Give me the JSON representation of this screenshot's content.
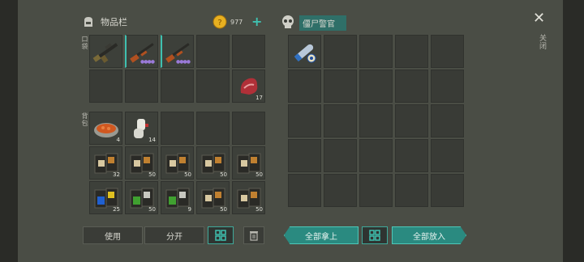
{
  "inventory": {
    "title": "物品栏",
    "pocket_label": "口袋",
    "backpack_label": "背包",
    "coins": "977",
    "add_symbol": "+"
  },
  "pocket_items": [
    {
      "icon": "rifle-icon",
      "count": ""
    },
    {
      "icon": "shotgun-icon",
      "count": "",
      "dots": "●●●●"
    },
    {
      "icon": "shotgun-icon",
      "count": "",
      "dots": "●●●●"
    },
    {
      "icon": "",
      "count": ""
    },
    {
      "icon": "",
      "count": ""
    },
    {
      "icon": "",
      "count": ""
    },
    {
      "icon": "",
      "count": ""
    },
    {
      "icon": "",
      "count": ""
    },
    {
      "icon": "",
      "count": ""
    },
    {
      "icon": "raw-meat-icon",
      "count": "17"
    }
  ],
  "backpack_items": [
    {
      "icon": "stew-bowl-icon",
      "count": "4"
    },
    {
      "icon": "bandage-icon",
      "count": "14"
    },
    {
      "icon": "",
      "count": ""
    },
    {
      "icon": "",
      "count": ""
    },
    {
      "icon": "",
      "count": ""
    },
    {
      "icon": "wood-plank-icon",
      "count": "32"
    },
    {
      "icon": "wood-plank-icon",
      "count": "50"
    },
    {
      "icon": "wood-plank-icon",
      "count": "50"
    },
    {
      "icon": "wood-plank-icon",
      "count": "50"
    },
    {
      "icon": "wood-plank-icon",
      "count": "50"
    },
    {
      "icon": "blue-paint-icon",
      "count": "25"
    },
    {
      "icon": "green-paint-icon",
      "count": "50"
    },
    {
      "icon": "green-paint-icon",
      "count": "9"
    },
    {
      "icon": "wood-plank-icon",
      "count": "50"
    },
    {
      "icon": "wood-plank-icon",
      "count": "50"
    }
  ],
  "loot": {
    "title": "僵尸警官",
    "first_item": "rolled-map-icon"
  },
  "buttons": {
    "use": "使用",
    "split": "分开",
    "take_all": "全部拿上",
    "put_all": "全部放入"
  },
  "close": {
    "label": "关闭",
    "symbol": "✕"
  },
  "colors": {
    "accent": "#3fc0b0",
    "coin": "#e8b020"
  }
}
